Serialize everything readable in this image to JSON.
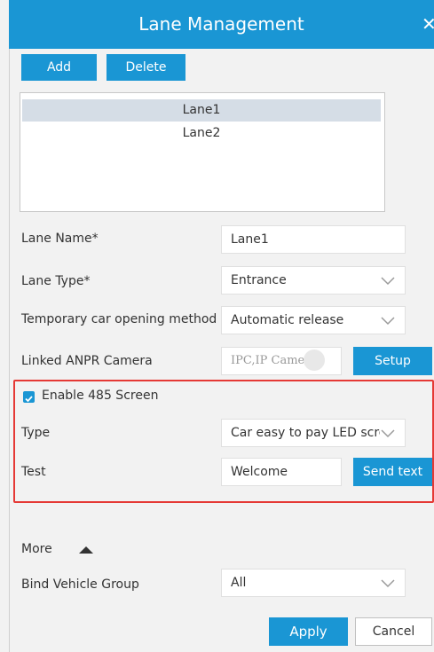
{
  "dialog": {
    "title": "Lane Management",
    "close_glyph": "✕"
  },
  "toolbar": {
    "add_label": "Add",
    "delete_label": "Delete"
  },
  "lanes": [
    {
      "label": "Lane1",
      "selected": true
    },
    {
      "label": "Lane2",
      "selected": false
    }
  ],
  "form": {
    "lane_name_label": "Lane Name*",
    "lane_name_value": "Lane1",
    "lane_type_label": "Lane Type*",
    "lane_type_value": "Entrance",
    "temp_car_label": "Temporary car opening method",
    "temp_car_value": "Automatic release",
    "anpr_label": "Linked ANPR Camera",
    "anpr_value": "IPC,IP Camera",
    "setup_label": "Setup"
  },
  "screen485": {
    "enable_label": "Enable 485 Screen",
    "enabled": true,
    "type_label": "Type",
    "type_value": "Car easy to pay LED scree",
    "test_label": "Test",
    "test_value": "Welcome",
    "send_label": "Send text"
  },
  "more": {
    "more_label": "More",
    "bind_group_label": "Bind Vehicle Group",
    "bind_group_value": "All"
  },
  "footer": {
    "apply_label": "Apply",
    "cancel_label": "Cancel"
  },
  "colors": {
    "accent": "#1a96d4",
    "highlight_border": "#e53935",
    "selected_row": "#d5dde6"
  }
}
